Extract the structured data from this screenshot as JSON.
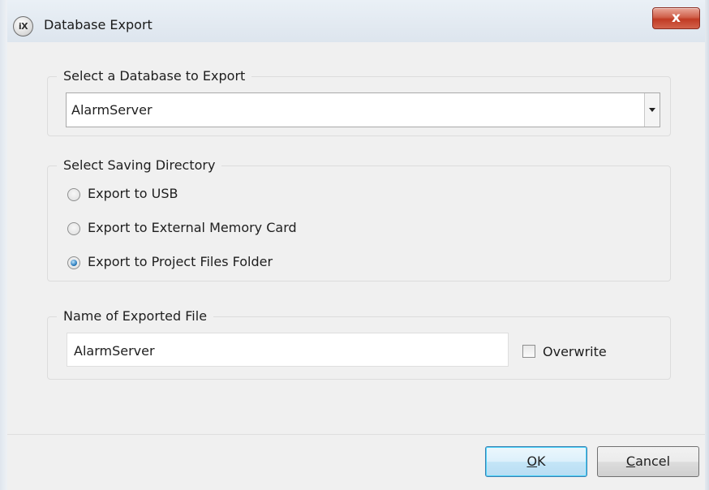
{
  "window": {
    "title": "Database Export",
    "app_icon_text": "iX",
    "close_label": "x"
  },
  "database_group": {
    "legend": "Select a Database to Export",
    "selected_value": "AlarmServer"
  },
  "directory_group": {
    "legend": "Select Saving Directory",
    "options": [
      {
        "label": "Export to USB",
        "checked": false
      },
      {
        "label": "Export to External Memory Card",
        "checked": false
      },
      {
        "label": "Export to Project Files Folder",
        "checked": true
      }
    ]
  },
  "filename_group": {
    "legend": "Name of Exported File",
    "value": "AlarmServer",
    "overwrite_label": "Overwrite",
    "overwrite_checked": false
  },
  "buttons": {
    "ok_mnemonic": "O",
    "ok_rest": "K",
    "cancel_mnemonic": "C",
    "cancel_rest": "ancel"
  }
}
